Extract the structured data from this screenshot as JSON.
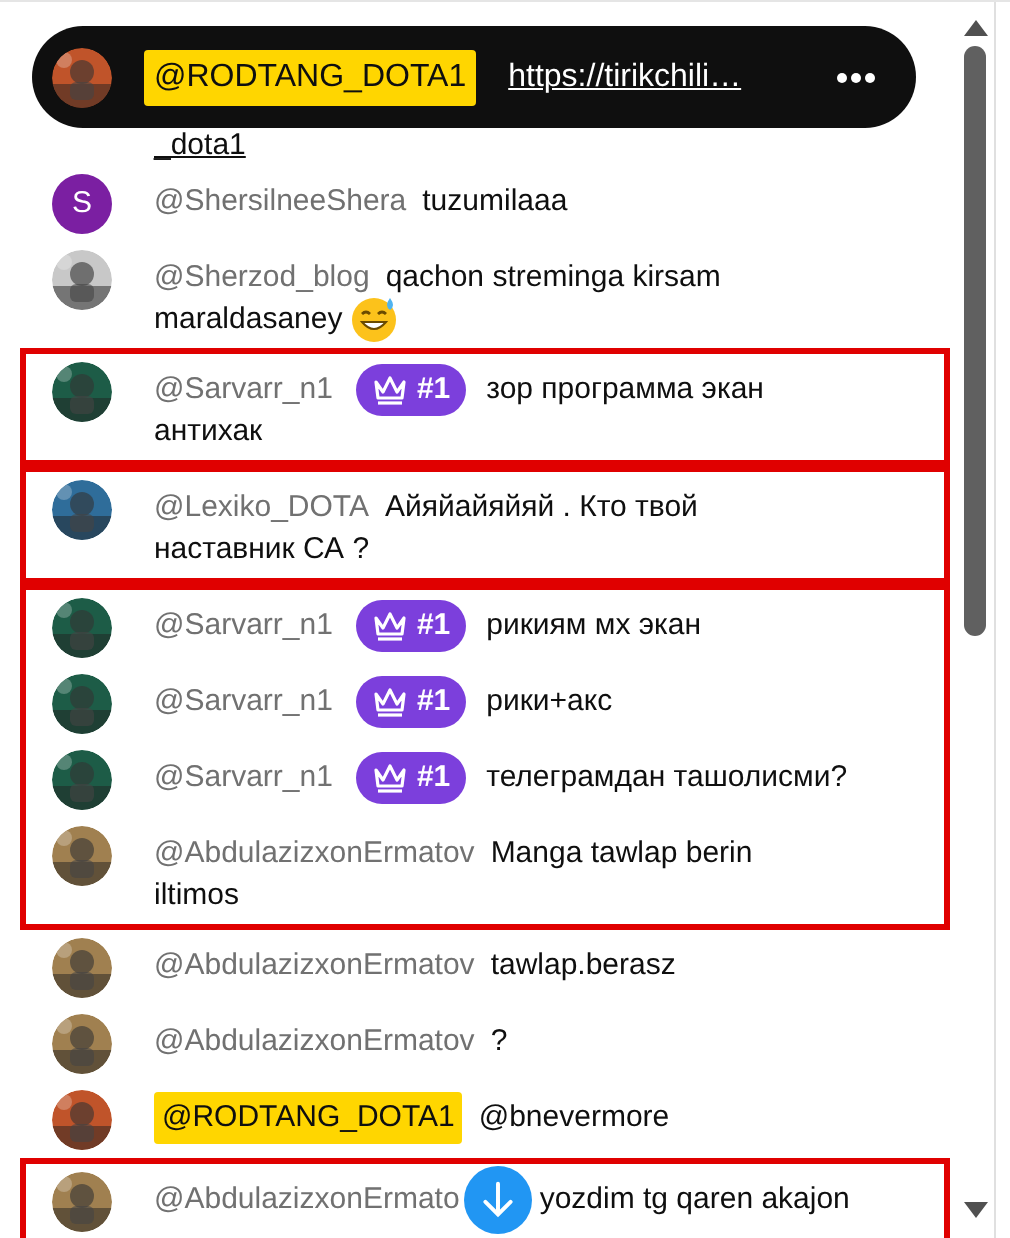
{
  "pinned": {
    "author": "@RODTANG_DOTA1",
    "link": "https://tirikchili…",
    "avatar": {
      "kind": "picture",
      "color": "#c0542a"
    }
  },
  "segments": [
    {
      "boxed": false,
      "messages": [
        {
          "kind": "continuation",
          "link": "_dota1"
        },
        {
          "kind": "message",
          "author": "@ShersilneeShera",
          "author_highlight": false,
          "lines": [
            "tuzumilaaa"
          ],
          "emoji": false,
          "avatar": {
            "kind": "letter",
            "letter": "S",
            "color": "#7b1fa2"
          }
        },
        {
          "kind": "message",
          "author": "@Sherzod_blog",
          "author_highlight": false,
          "lines": [
            "qachon streminga kirsam",
            "maraldasaney"
          ],
          "emoji": true,
          "avatar": {
            "kind": "picture",
            "color": "#c8c8c8"
          }
        }
      ]
    },
    {
      "boxed": true,
      "messages": [
        {
          "kind": "message",
          "author": "@Sarvarr_n1",
          "author_highlight": false,
          "badge": "#1",
          "lines": [
            "зор программа экан",
            "антихак"
          ],
          "emoji": false,
          "avatar": {
            "kind": "picture",
            "color": "#1d5c47"
          }
        }
      ]
    },
    {
      "boxed": true,
      "messages": [
        {
          "kind": "message",
          "author": "@Lexiko_DOTA",
          "author_highlight": false,
          "lines": [
            "Айяйайяйяй . Кто твой",
            "наставник СА ?"
          ],
          "emoji": false,
          "avatar": {
            "kind": "picture",
            "color": "#2f6d9a"
          }
        }
      ]
    },
    {
      "boxed": true,
      "messages": [
        {
          "kind": "message",
          "author": "@Sarvarr_n1",
          "author_highlight": false,
          "badge": "#1",
          "lines": [
            "рикиям мх экан"
          ],
          "emoji": false,
          "avatar": {
            "kind": "picture",
            "color": "#1d5c47"
          }
        },
        {
          "kind": "message",
          "author": "@Sarvarr_n1",
          "author_highlight": false,
          "badge": "#1",
          "lines": [
            "рики+акс"
          ],
          "emoji": false,
          "avatar": {
            "kind": "picture",
            "color": "#1d5c47"
          }
        },
        {
          "kind": "message",
          "author": "@Sarvarr_n1",
          "author_highlight": false,
          "badge": "#1",
          "lines": [
            "телеграмдан ташолисми?"
          ],
          "emoji": false,
          "avatar": {
            "kind": "picture",
            "color": "#1d5c47"
          }
        },
        {
          "kind": "message",
          "author": "@AbdulazizxonErmatov",
          "author_highlight": false,
          "lines": [
            "Manga tawlap berin",
            "iltimos"
          ],
          "emoji": false,
          "avatar": {
            "kind": "picture",
            "color": "#a08050"
          }
        }
      ]
    },
    {
      "boxed": false,
      "messages": [
        {
          "kind": "message",
          "author": "@AbdulazizxonErmatov",
          "author_highlight": false,
          "lines": [
            "tawlap.berasz"
          ],
          "emoji": false,
          "avatar": {
            "kind": "picture",
            "color": "#a08050"
          }
        },
        {
          "kind": "message",
          "author": "@AbdulazizxonErmatov",
          "author_highlight": false,
          "lines": [
            "?"
          ],
          "emoji": false,
          "avatar": {
            "kind": "picture",
            "color": "#a08050"
          }
        },
        {
          "kind": "message",
          "author": "@RODTANG_DOTA1",
          "author_highlight": true,
          "lines": [
            "@bnevermore"
          ],
          "emoji": false,
          "avatar": {
            "kind": "picture",
            "color": "#c0542a"
          }
        }
      ]
    },
    {
      "boxed": true,
      "messages": [
        {
          "kind": "message",
          "author": "@AbdulazizxonErmato",
          "author_highlight": false,
          "scroll_button": true,
          "lines": [
            "yozdim tg qaren akajon"
          ],
          "emoji": false,
          "avatar": {
            "kind": "picture",
            "color": "#a08050"
          }
        }
      ]
    }
  ]
}
